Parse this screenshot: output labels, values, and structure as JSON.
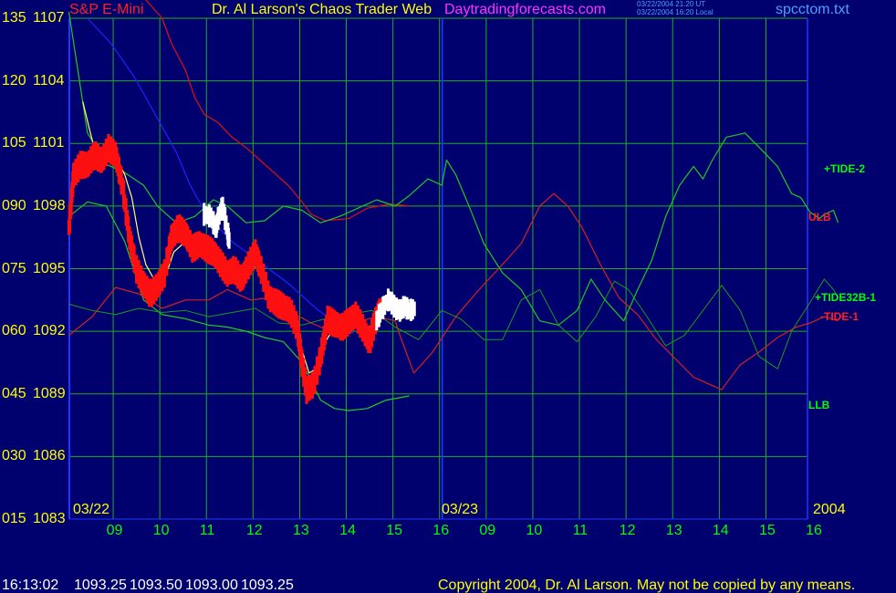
{
  "header": {
    "instrument": "S&P E-Mini",
    "title": "Dr. Al Larson's Chaos Trader Web",
    "site": "Daytradingforecasts.com",
    "timestamp_line1": "03/22/2004 21:20 UT",
    "timestamp_line2": "03/22/2004 16:20 Local",
    "file": "spcctom.txt"
  },
  "footer": {
    "time": "16:13:02",
    "open": "1093.25",
    "high": "1093.50",
    "low": "1093.00",
    "close": "1093.25",
    "copyright": "Copyright 2004, Dr. Al Larson. May not be copied by any means."
  },
  "colors": {
    "background": "#00006e",
    "grid": "#1fae1f",
    "axis": "#1f37ff",
    "price": "#ff1010",
    "future": "#ffffff",
    "band_upper": "#e01010",
    "band_lower": "#22cc22",
    "tide2": "#20c820",
    "tide32b": "#1c9a1c",
    "tide1": "#d82020",
    "blue_curve": "#2020ff",
    "average": "#ffff80"
  },
  "chart_data": {
    "type": "line",
    "y_left_labels": [
      "135",
      "120",
      "105",
      "090",
      "075",
      "060",
      "045",
      "030",
      "015"
    ],
    "y_price_labels": [
      "1107",
      "1104",
      "1101",
      "1098",
      "1095",
      "1092",
      "1089",
      "1086",
      "1083"
    ],
    "ylim": [
      1083,
      1107
    ],
    "x_hour_labels": [
      "09",
      "10",
      "11",
      "12",
      "13",
      "14",
      "15",
      "16",
      "09",
      "10",
      "11",
      "12",
      "13",
      "14",
      "15",
      "16"
    ],
    "x_date_labels": [
      "03/22",
      "03/23"
    ],
    "year_label": "2004",
    "series": [
      {
        "name": "+TIDE-2",
        "label": "+TIDE-2"
      },
      {
        "name": "ULB",
        "label": "ULB"
      },
      {
        "name": "+TIDE32B-1",
        "label": "+TIDE32B-1"
      },
      {
        "name": "-TIDE-1",
        "label": "-TIDE-1"
      },
      {
        "name": "LLB",
        "label": "LLB"
      }
    ],
    "price_path": [
      [
        0,
        1097
      ],
      [
        0.1,
        1099.5
      ],
      [
        0.25,
        1100
      ],
      [
        0.4,
        1100
      ],
      [
        0.55,
        1100.5
      ],
      [
        0.7,
        1100.2
      ],
      [
        0.85,
        1100.8
      ],
      [
        1.0,
        1100.5
      ],
      [
        1.15,
        1099
      ],
      [
        1.3,
        1096.5
      ],
      [
        1.45,
        1095
      ],
      [
        1.6,
        1094.3
      ],
      [
        1.75,
        1093.8
      ],
      [
        1.9,
        1094.2
      ],
      [
        2.05,
        1094.8
      ],
      [
        2.2,
        1096.5
      ],
      [
        2.35,
        1097
      ],
      [
        2.5,
        1096.7
      ],
      [
        2.65,
        1096
      ],
      [
        2.8,
        1096.2
      ],
      [
        2.95,
        1096
      ],
      [
        3.1,
        1095.8
      ],
      [
        3.25,
        1095.3
      ],
      [
        3.4,
        1094.8
      ],
      [
        3.55,
        1095
      ],
      [
        3.7,
        1094.5
      ],
      [
        3.85,
        1095.2
      ],
      [
        4.0,
        1095.8
      ],
      [
        4.15,
        1094.8
      ],
      [
        4.3,
        1093.6
      ],
      [
        4.45,
        1093.4
      ],
      [
        4.6,
        1093.2
      ],
      [
        4.75,
        1093
      ],
      [
        4.9,
        1092.2
      ],
      [
        5.0,
        1090.5
      ],
      [
        5.1,
        1089.2
      ],
      [
        5.25,
        1089.5
      ],
      [
        5.4,
        1090.8
      ],
      [
        5.55,
        1092.6
      ],
      [
        5.7,
        1092.4
      ],
      [
        5.85,
        1092.2
      ],
      [
        6.0,
        1092.5
      ],
      [
        6.15,
        1092.8
      ],
      [
        6.3,
        1092.2
      ],
      [
        6.45,
        1091.5
      ],
      [
        6.55,
        1092.4
      ],
      [
        6.7,
        1093.2
      ]
    ],
    "future_path": [
      [
        2.9,
        1097.6
      ],
      [
        3.05,
        1097.5
      ],
      [
        3.15,
        1096.9
      ],
      [
        3.2,
        1097.4
      ],
      [
        3.3,
        1098.0
      ],
      [
        3.4,
        1096.8
      ],
      [
        3.45,
        1096.2
      ],
      [
        6.6,
        1092.5
      ],
      [
        6.7,
        1093.0
      ],
      [
        6.85,
        1093.5
      ],
      [
        6.95,
        1093.3
      ],
      [
        7.0,
        1093.1
      ],
      [
        7.1,
        1093.0
      ],
      [
        7.2,
        1093.2
      ],
      [
        7.3,
        1093.0
      ],
      [
        7.45,
        1093.1
      ]
    ],
    "average_path": [
      [
        0.3,
        1103
      ],
      [
        0.45,
        1101.6
      ],
      [
        0.6,
        1100.3
      ],
      [
        0.75,
        1100
      ],
      [
        0.9,
        1100.4
      ],
      [
        1.05,
        1100.2
      ],
      [
        1.2,
        1099.5
      ],
      [
        1.35,
        1098.4
      ],
      [
        1.5,
        1096.5
      ],
      [
        1.65,
        1095.2
      ],
      [
        1.85,
        1094.4
      ],
      [
        2.05,
        1094.5
      ],
      [
        2.25,
        1095.8
      ],
      [
        2.45,
        1096.2
      ],
      [
        2.65,
        1096.1
      ],
      [
        2.85,
        1095.9
      ],
      [
        3.05,
        1095.6
      ],
      [
        3.25,
        1095.3
      ],
      [
        3.45,
        1095.0
      ],
      [
        3.65,
        1094.8
      ],
      [
        3.85,
        1095.0
      ],
      [
        4.05,
        1095.1
      ],
      [
        4.25,
        1094.3
      ],
      [
        4.45,
        1093.6
      ],
      [
        4.65,
        1093.1
      ],
      [
        4.85,
        1092.3
      ],
      [
        5.0,
        1091.1
      ],
      [
        5.15,
        1090.0
      ],
      [
        5.3,
        1090.2
      ],
      [
        5.5,
        1091.5
      ],
      [
        5.7,
        1092.2
      ],
      [
        5.9,
        1092.3
      ],
      [
        6.1,
        1092.5
      ],
      [
        6.3,
        1092.3
      ],
      [
        6.5,
        1092.2
      ],
      [
        6.7,
        1092.8
      ],
      [
        6.9,
        1093.3
      ],
      [
        7.1,
        1093.2
      ],
      [
        7.3,
        1093.1
      ]
    ],
    "upper_band": [
      [
        0,
        1109
      ],
      [
        1.2,
        1109
      ],
      [
        1.6,
        1108
      ],
      [
        2.0,
        1107
      ],
      [
        2.2,
        1105.8
      ],
      [
        2.5,
        1104.5
      ],
      [
        2.7,
        1103.2
      ],
      [
        2.9,
        1102.4
      ],
      [
        3.2,
        1102.0
      ],
      [
        3.5,
        1101.3
      ],
      [
        3.8,
        1100.8
      ],
      [
        4.1,
        1100.2
      ],
      [
        4.4,
        1099.6
      ],
      [
        4.7,
        1099.0
      ],
      [
        5.0,
        1098.2
      ],
      [
        5.2,
        1097.6
      ],
      [
        5.5,
        1097.3
      ],
      [
        6.0,
        1097.4
      ],
      [
        6.4,
        1097.9
      ],
      [
        6.9,
        1098.1
      ],
      [
        7.3,
        1098.0
      ]
    ],
    "lower_band": [
      [
        0,
        1097.5
      ],
      [
        0.4,
        1098.2
      ],
      [
        0.8,
        1098.0
      ],
      [
        1.2,
        1096.3
      ],
      [
        1.6,
        1093.5
      ],
      [
        2.0,
        1092.8
      ],
      [
        2.5,
        1092.6
      ],
      [
        3.0,
        1092.3
      ],
      [
        3.4,
        1092.2
      ],
      [
        3.8,
        1092.0
      ],
      [
        4.2,
        1091.7
      ],
      [
        4.6,
        1091.5
      ],
      [
        5.0,
        1090.5
      ],
      [
        5.4,
        1088.7
      ],
      [
        5.7,
        1088.3
      ],
      [
        6.0,
        1088.2
      ],
      [
        6.4,
        1088.3
      ],
      [
        6.8,
        1088.7
      ],
      [
        7.3,
        1088.9
      ]
    ],
    "tide2": [
      [
        0,
        1107.3
      ],
      [
        0.4,
        1101.5
      ],
      [
        0.8,
        1100.0
      ],
      [
        1.2,
        1099.6
      ],
      [
        1.6,
        1099.0
      ],
      [
        1.9,
        1098.0
      ],
      [
        2.3,
        1097.2
      ],
      [
        2.7,
        1097.5
      ],
      [
        3.1,
        1098.3
      ],
      [
        3.4,
        1098.0
      ],
      [
        3.8,
        1097.2
      ],
      [
        4.2,
        1097.3
      ],
      [
        4.6,
        1098.0
      ],
      [
        5.0,
        1097.8
      ],
      [
        5.4,
        1097.2
      ],
      [
        5.8,
        1097.5
      ],
      [
        6.2,
        1097.9
      ],
      [
        6.6,
        1098.3
      ],
      [
        7.0,
        1098.0
      ],
      [
        7.3,
        1098.5
      ],
      [
        7.7,
        1099.3
      ],
      [
        8.0,
        1099.0
      ],
      [
        8.1,
        1100.2
      ],
      [
        8.3,
        1099.5
      ],
      [
        8.6,
        1097.9
      ],
      [
        8.9,
        1096.2
      ],
      [
        9.3,
        1094.8
      ],
      [
        9.7,
        1094.0
      ],
      [
        10.1,
        1092.5
      ],
      [
        10.5,
        1092.3
      ],
      [
        10.9,
        1093.0
      ],
      [
        11.2,
        1094.5
      ],
      [
        11.5,
        1093.5
      ],
      [
        11.9,
        1092.5
      ],
      [
        12.2,
        1094.0
      ],
      [
        12.5,
        1095.4
      ],
      [
        12.8,
        1097.5
      ],
      [
        13.1,
        1099.0
      ],
      [
        13.4,
        1099.9
      ],
      [
        13.6,
        1099.3
      ],
      [
        13.8,
        1100.2
      ],
      [
        14.1,
        1101.3
      ],
      [
        14.5,
        1101.5
      ],
      [
        14.9,
        1100.6
      ],
      [
        15.2,
        1099.9
      ],
      [
        15.5,
        1098.6
      ],
      [
        15.7,
        1098.4
      ],
      [
        15.9,
        1097.7
      ],
      [
        16.1,
        1097.4
      ],
      [
        16.2,
        1097.6
      ],
      [
        16.4,
        1097.8
      ],
      [
        16.5,
        1097.2
      ]
    ],
    "tide32b": [
      [
        0,
        1093.3
      ],
      [
        0.5,
        1093.0
      ],
      [
        1.0,
        1092.8
      ],
      [
        1.5,
        1093.1
      ],
      [
        2.0,
        1092.9
      ],
      [
        2.5,
        1093.0
      ],
      [
        3.0,
        1092.7
      ],
      [
        3.5,
        1092.9
      ],
      [
        4.0,
        1093.1
      ],
      [
        4.5,
        1092.4
      ],
      [
        5.0,
        1092.3
      ],
      [
        5.5,
        1092.6
      ],
      [
        6.0,
        1092.8
      ],
      [
        6.5,
        1093.0
      ],
      [
        7.0,
        1092.2
      ],
      [
        7.5,
        1091.6
      ],
      [
        8.0,
        1093.0
      ],
      [
        8.4,
        1092.6
      ],
      [
        8.9,
        1091.6
      ],
      [
        9.3,
        1091.6
      ],
      [
        9.7,
        1093.5
      ],
      [
        10.1,
        1094.0
      ],
      [
        10.5,
        1092.3
      ],
      [
        10.9,
        1091.5
      ],
      [
        11.3,
        1092.7
      ],
      [
        11.7,
        1094.4
      ],
      [
        12.0,
        1094.0
      ],
      [
        12.4,
        1092.7
      ],
      [
        12.8,
        1091.3
      ],
      [
        13.2,
        1091.8
      ],
      [
        13.6,
        1093.0
      ],
      [
        14.0,
        1094.2
      ],
      [
        14.4,
        1093.0
      ],
      [
        14.8,
        1090.8
      ],
      [
        15.2,
        1090.2
      ],
      [
        15.5,
        1092.0
      ],
      [
        15.9,
        1093.4
      ],
      [
        16.2,
        1094.5
      ],
      [
        16.4,
        1094.0
      ],
      [
        16.5,
        1093.6
      ]
    ],
    "tide1": [
      [
        0,
        1091.8
      ],
      [
        0.5,
        1092.7
      ],
      [
        1.0,
        1094.1
      ],
      [
        1.5,
        1093.8
      ],
      [
        2.0,
        1093.1
      ],
      [
        2.5,
        1093.5
      ],
      [
        3.0,
        1093.5
      ],
      [
        3.4,
        1094.0
      ],
      [
        3.9,
        1093.5
      ],
      [
        4.3,
        1093.6
      ],
      [
        4.7,
        1093.0
      ],
      [
        5.2,
        1092.4
      ],
      [
        5.6,
        1092.0
      ],
      [
        6.1,
        1092.4
      ],
      [
        6.6,
        1092.7
      ],
      [
        7.0,
        1092.5
      ],
      [
        7.1,
        1091.8
      ],
      [
        7.4,
        1090.0
      ],
      [
        7.8,
        1091.0
      ],
      [
        8.3,
        1092.7
      ],
      [
        8.8,
        1094.0
      ],
      [
        9.3,
        1095.2
      ],
      [
        9.7,
        1096.2
      ],
      [
        10.1,
        1098.0
      ],
      [
        10.4,
        1098.6
      ],
      [
        10.7,
        1098.0
      ],
      [
        11.0,
        1097.0
      ],
      [
        11.4,
        1095.2
      ],
      [
        11.8,
        1093.6
      ],
      [
        12.2,
        1092.8
      ],
      [
        12.6,
        1091.6
      ],
      [
        13.0,
        1090.7
      ],
      [
        13.4,
        1089.8
      ],
      [
        13.7,
        1089.5
      ],
      [
        14.0,
        1089.2
      ],
      [
        14.4,
        1090.4
      ],
      [
        14.8,
        1091.0
      ],
      [
        15.2,
        1091.7
      ],
      [
        15.6,
        1092.2
      ],
      [
        15.9,
        1092.4
      ],
      [
        16.2,
        1092.7
      ],
      [
        16.5,
        1092.5
      ]
    ],
    "blue_curve": [
      [
        0.4,
        1107
      ],
      [
        0.9,
        1105.8
      ],
      [
        1.4,
        1104.2
      ],
      [
        1.9,
        1102.2
      ],
      [
        2.3,
        1100.6
      ],
      [
        2.6,
        1099.0
      ],
      [
        2.9,
        1097.8
      ],
      [
        3.2,
        1097.0
      ],
      [
        3.5,
        1096.3
      ],
      [
        3.8,
        1095.8
      ],
      [
        4.1,
        1095.3
      ],
      [
        4.4,
        1094.8
      ],
      [
        4.7,
        1094.3
      ],
      [
        5.0,
        1093.7
      ],
      [
        5.3,
        1093.1
      ],
      [
        5.6,
        1092.6
      ],
      [
        5.9,
        1092.2
      ],
      [
        6.1,
        1091.9
      ]
    ]
  }
}
